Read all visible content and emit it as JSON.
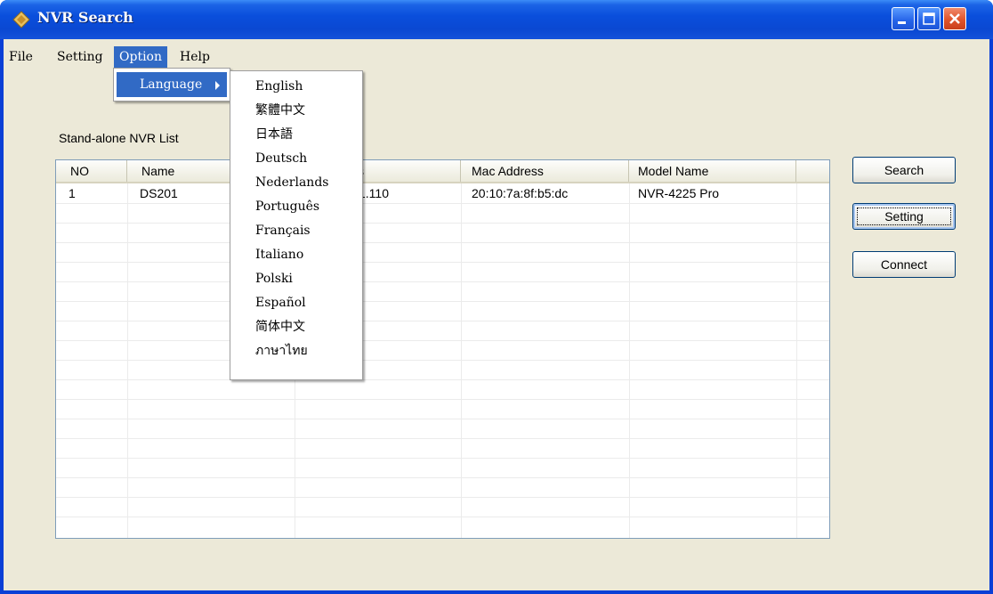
{
  "window": {
    "title": "NVR Search"
  },
  "menubar": {
    "items": [
      "File",
      "Setting",
      "Option",
      "Help"
    ],
    "active": "Option"
  },
  "option_menu": {
    "language_label": "Language"
  },
  "language_menu": {
    "items": [
      "English",
      "繁體中文",
      "日本語",
      "Deutsch",
      "Nederlands",
      "Português",
      "Français",
      "Italiano",
      "Polski",
      "Español",
      "简体中文",
      "ภาษาไทย"
    ]
  },
  "list": {
    "label": "Stand-alone NVR List",
    "columns": [
      "NO",
      "Name",
      "IP Address",
      "Mac Address",
      "Model Name"
    ],
    "visible_header_fragments": {
      "ip": "ss"
    },
    "rows": [
      {
        "no": "1",
        "name": "DS201",
        "ip_visible": "1.110",
        "mac": "20:10:7a:8f:b5:dc",
        "model": "NVR-4225 Pro"
      }
    ]
  },
  "buttons": {
    "search": "Search",
    "setting": "Setting",
    "connect": "Connect"
  },
  "colors": {
    "titlebar": "#0a48d2",
    "menu_highlight": "#316ac5",
    "client_bg": "#ece9d8"
  }
}
